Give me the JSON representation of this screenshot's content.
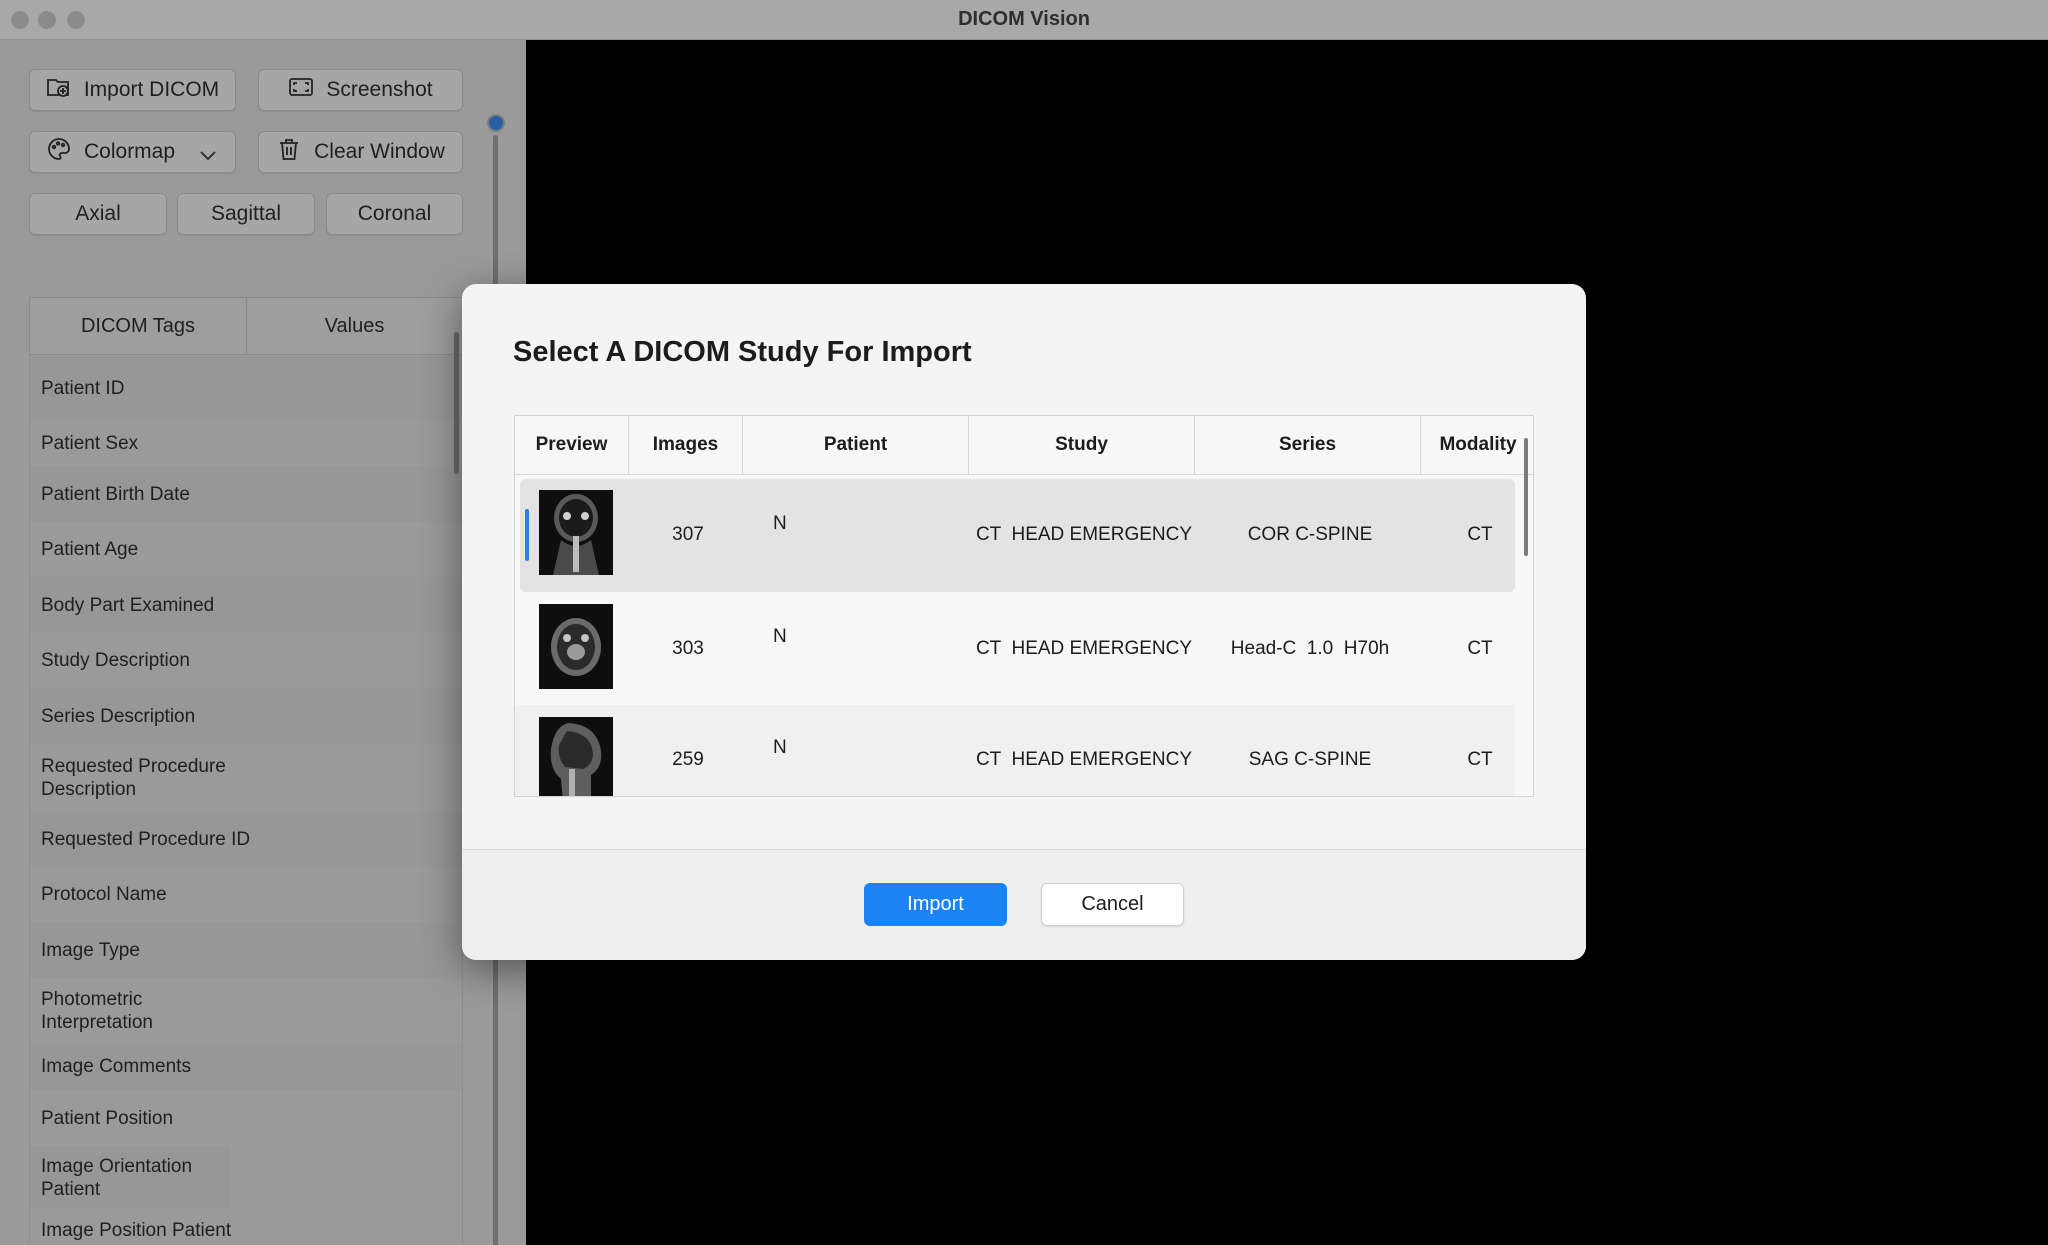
{
  "window": {
    "title": "DICOM Vision"
  },
  "toolbar": {
    "import_label": "Import DICOM",
    "screenshot_label": "Screenshot",
    "colormap_label": "Colormap",
    "clear_label": "Clear Window",
    "axial_label": "Axial",
    "sagittal_label": "Sagittal",
    "coronal_label": "Coronal"
  },
  "tags_table": {
    "headers": [
      "DICOM Tags",
      "Values"
    ],
    "rows": [
      "Patient ID",
      "Patient Sex",
      "Patient Birth Date",
      "Patient Age",
      "Body Part Examined",
      "Study Description",
      "Series Description",
      "Requested Procedure Description",
      "Requested Procedure ID",
      "Protocol Name",
      "Image Type",
      "Photometric Interpretation",
      "Image Comments",
      "Patient Position",
      "Image Orientation Patient",
      "Image Position Patient"
    ]
  },
  "dialog": {
    "title": "Select A DICOM Study For Import",
    "headers": [
      "Preview",
      "Images",
      "Patient",
      "Study",
      "Series",
      "Modality"
    ],
    "rows": [
      {
        "images": "307",
        "patient": "N",
        "study": "CT  HEAD EMERGENCY",
        "series": "COR C-SPINE",
        "modality": "CT"
      },
      {
        "images": "303",
        "patient": "N",
        "study": "CT  HEAD EMERGENCY",
        "series": "Head-C  1.0  H70h",
        "modality": "CT"
      },
      {
        "images": "259",
        "patient": "N",
        "study": "CT  HEAD EMERGENCY",
        "series": "SAG C-SPINE",
        "modality": "CT"
      }
    ],
    "import_label": "Import",
    "cancel_label": "Cancel"
  },
  "colors": {
    "accent": "#1a84f5",
    "selection_bar": "#2f7de1"
  }
}
